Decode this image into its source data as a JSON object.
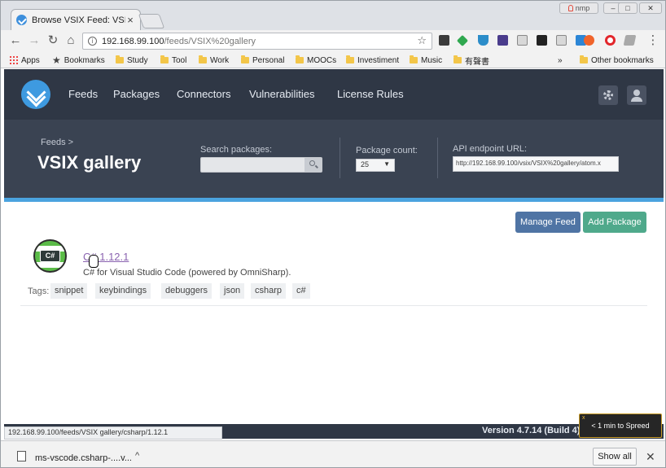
{
  "browser": {
    "tab_title": "Browse VSIX Feed: VSIX g",
    "tab_close": "×",
    "window_user": "nmp",
    "window_buttons": [
      "–",
      "□",
      "✕"
    ],
    "url_host": "192.168.99.100",
    "url_path": "/feeds/VSIX%20gallery",
    "bookmarks": [
      {
        "label": "Apps",
        "icon": "apps-icon"
      },
      {
        "label": "Bookmarks",
        "icon": "star-icon"
      },
      {
        "label": "Study",
        "icon": "folder-icon"
      },
      {
        "label": "Tool",
        "icon": "folder-icon"
      },
      {
        "label": "Work",
        "icon": "folder-icon"
      },
      {
        "label": "Personal",
        "icon": "folder-icon"
      },
      {
        "label": "MOOCs",
        "icon": "folder-icon"
      },
      {
        "label": "Investiment",
        "icon": "folder-icon"
      },
      {
        "label": "Music",
        "icon": "folder-icon"
      },
      {
        "label": "有聲書",
        "icon": "folder-icon"
      }
    ],
    "bookmarks_overflow": "»",
    "other_bookmarks": "Other bookmarks"
  },
  "header": {
    "nav": [
      "Feeds",
      "Packages",
      "Connectors",
      "Vulnerabilities",
      "License Rules"
    ]
  },
  "feed": {
    "breadcrumb": "Feeds >",
    "title": "VSIX gallery",
    "search_label": "Search packages:",
    "search_value": "",
    "count_label": "Package count:",
    "count_value": "25",
    "api_label": "API endpoint URL:",
    "api_url": "http://192.168.99.100/vsix/VSIX%20gallery/atom.x"
  },
  "actions": {
    "manage_feed": "Manage Feed",
    "add_package": "Add Package"
  },
  "package": {
    "icon_text": "C#",
    "name": "C# 1.12.1",
    "description": "C# for Visual Studio Code (powered by OmniSharp).",
    "tags_label": "Tags:",
    "tags": [
      "snippet",
      "keybindings",
      "debuggers",
      "json",
      "csharp",
      "c#"
    ]
  },
  "footer": {
    "status_url": "192.168.99.100/feeds/VSIX gallery/csharp/1.12.1",
    "version": "Version 4.7.14 (Build 4)",
    "toast": "< 1 min to Spreed",
    "toast_close": "x"
  },
  "downloads": {
    "file_name": "ms-vscode.csharp-....v...",
    "chevron": "^",
    "show_all": "Show all",
    "close": "✕"
  },
  "colors": {
    "nav_bg": "#2f3745",
    "subheader_bg": "#3a4352",
    "accent": "#4aa3df",
    "manage_btn": "#4f74a4",
    "add_btn": "#4fa98b",
    "link": "#8a63b0"
  }
}
